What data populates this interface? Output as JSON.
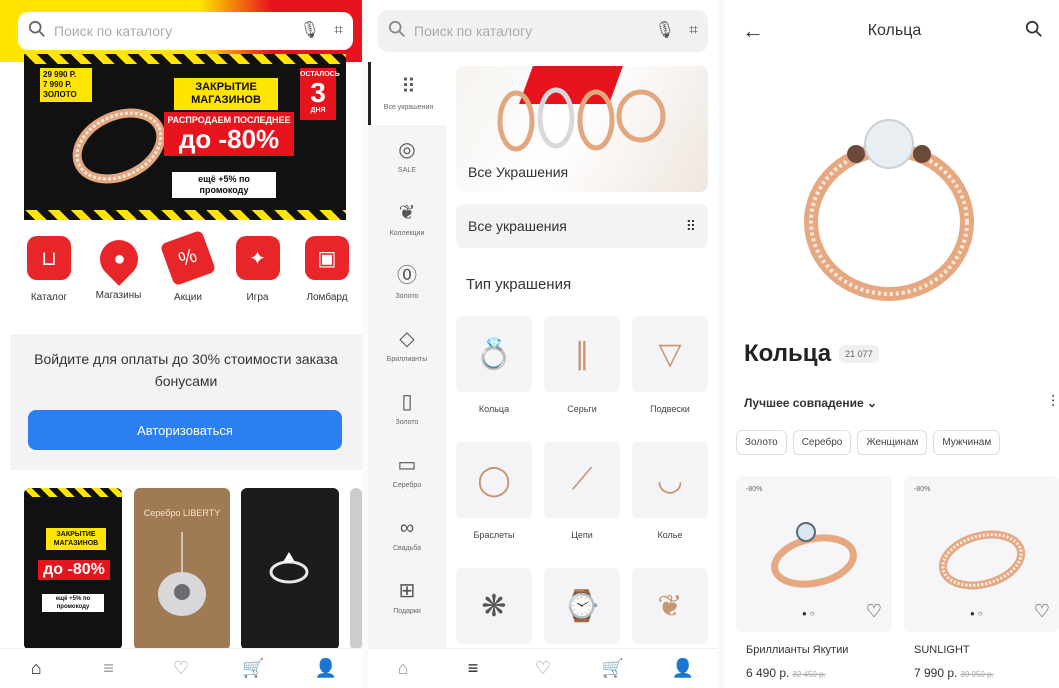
{
  "screen1": {
    "search": {
      "placeholder": "Поиск по каталогу"
    },
    "banner": {
      "price_old": "29 990 Р.",
      "price_new": "7 990 Р.",
      "metal": "ЗОЛОТО",
      "headline": "ЗАКРЫТИЕ МАГАЗИНОВ",
      "sale_line": "РАСПРОДАЕМ ПОСЛЕДНЕЕ",
      "discount": "до -80%",
      "bonus": "ещё +5% по промокоду",
      "days_top": "ОСТАЛОСЬ",
      "days_count": "3",
      "days_bottom": "ДНЯ"
    },
    "categories": [
      {
        "label": "Каталог",
        "icon": "catalog-bag-icon"
      },
      {
        "label": "Магазины",
        "icon": "map-pin-icon"
      },
      {
        "label": "Акции",
        "icon": "tag-icon"
      },
      {
        "label": "Игра",
        "icon": "gift-box-icon"
      },
      {
        "label": "Ломбард",
        "icon": "treasure-box-icon"
      }
    ],
    "login": {
      "text": "Войдите для оплаты до 30% стоимости заказа бонусами",
      "button": "Авторизоваться"
    },
    "promo_cards": {
      "card1_close": "ЗАКРЫТИЕ МАГАЗИНОВ",
      "card1_discount": "до -80%",
      "card1_bonus": "ещё +5% по промокоду",
      "card2_title": "Серебро LIBERTY"
    }
  },
  "screen2": {
    "search": {
      "placeholder": "Поиск по каталогу"
    },
    "sidebar": [
      {
        "label": "Все украшения",
        "icon": "grid-icon"
      },
      {
        "label": "SALE",
        "icon": "sale-percent-icon"
      },
      {
        "label": "Коллекции",
        "icon": "collections-icon"
      },
      {
        "label": "Золото",
        "icon": "gold-coin-icon"
      },
      {
        "label": "Бриллианты",
        "icon": "diamond-icon"
      },
      {
        "label": "Золото",
        "icon": "gold-bar-icon"
      },
      {
        "label": "Серебро",
        "icon": "silver-bar-icon"
      },
      {
        "label": "Свадьба",
        "icon": "wedding-rings-icon"
      },
      {
        "label": "Подарки",
        "icon": "gift-icon"
      }
    ],
    "hero_label": "Все Украшения",
    "all_row_label": "Все украшения",
    "type_heading": "Тип украшения",
    "types": [
      {
        "label": "Кольца",
        "glyph": "💍"
      },
      {
        "label": "Серьги",
        "glyph": "∥"
      },
      {
        "label": "Подвески",
        "glyph": "▽"
      },
      {
        "label": "Браслеты",
        "glyph": "◯"
      },
      {
        "label": "Цепи",
        "glyph": "⟋"
      },
      {
        "label": "Колье",
        "glyph": "◡"
      },
      {
        "label": "",
        "glyph": "❋"
      },
      {
        "label": "",
        "glyph": "⌚"
      },
      {
        "label": "",
        "glyph": "❦"
      }
    ]
  },
  "screen3": {
    "header_title": "Кольца",
    "title": "Кольца",
    "count": "21 077",
    "sort_label": "Лучшее совпадение",
    "chips": [
      "Золото",
      "Серебро",
      "Женщинам",
      "Мужчинам"
    ],
    "products": [
      {
        "badge": "-80%",
        "name": "Бриллианты Якутии",
        "price": "6 490 р.",
        "old_price": "32 450 р."
      },
      {
        "badge": "-80%",
        "name": "SUNLIGHT",
        "price": "7 990 р.",
        "old_price": "39 950 р."
      }
    ]
  },
  "tabbar": [
    {
      "icon": "home-icon"
    },
    {
      "icon": "catalog-search-icon"
    },
    {
      "icon": "heart-icon"
    },
    {
      "icon": "cart-icon"
    },
    {
      "icon": "profile-icon"
    }
  ],
  "colors": {
    "brand_red": "#e8262a",
    "accent_blue": "#2b7ff2",
    "banner_yellow": "#ffe500"
  }
}
